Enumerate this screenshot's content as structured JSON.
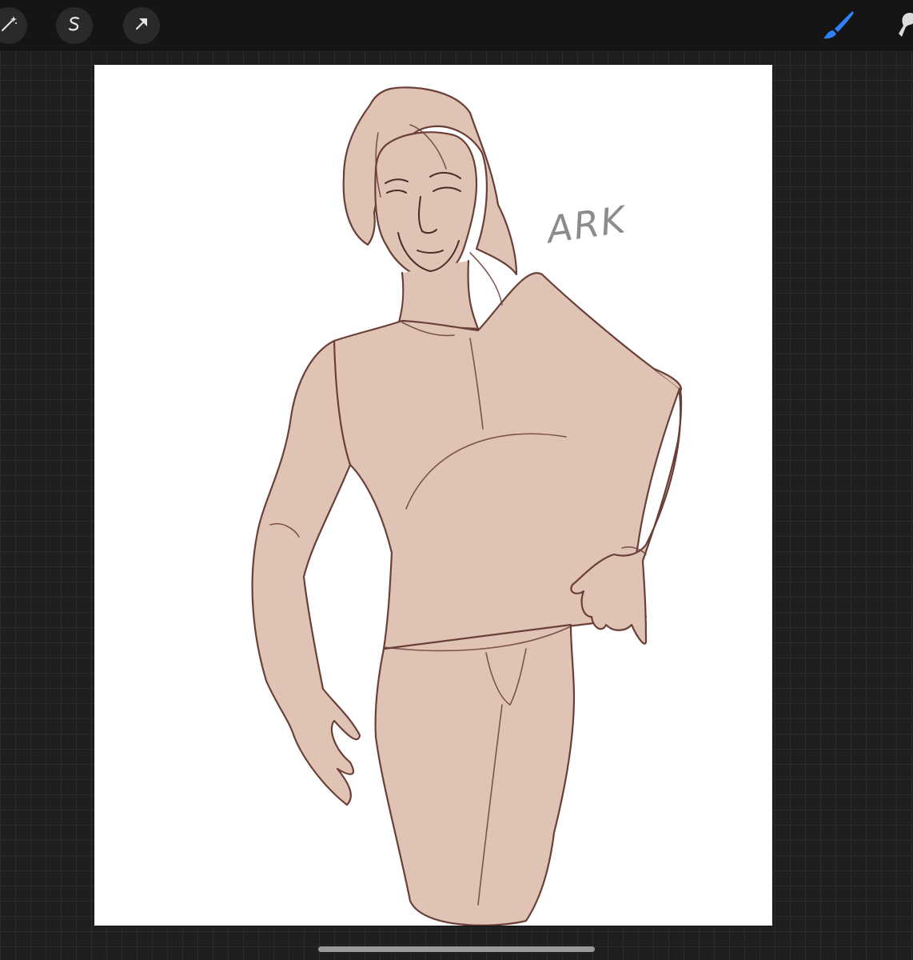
{
  "toolbar": {
    "left_tools": [
      {
        "name": "adjustments",
        "icon": "magic-wand-icon"
      },
      {
        "name": "selection",
        "icon": "selection-s-icon"
      },
      {
        "name": "transform",
        "icon": "arrow-cursor-icon"
      }
    ],
    "right_tools": [
      {
        "name": "brush",
        "icon": "brush-icon",
        "active": true
      },
      {
        "name": "smudge",
        "icon": "smudge-icon",
        "active": false
      }
    ]
  },
  "canvas": {
    "signature_text": "ARK"
  },
  "colors": {
    "toolbar_bg": "#151515",
    "workspace_bg": "#1f1f1f",
    "grid_line": "#2b2b2b",
    "tool_button_bg": "#2a2a2a",
    "active_tool": "#2f7ff7",
    "canvas_bg": "#ffffff",
    "skin_fill": "#dfc4b6",
    "line_art": "#6b3f38",
    "signature": "#8c8c8c"
  }
}
